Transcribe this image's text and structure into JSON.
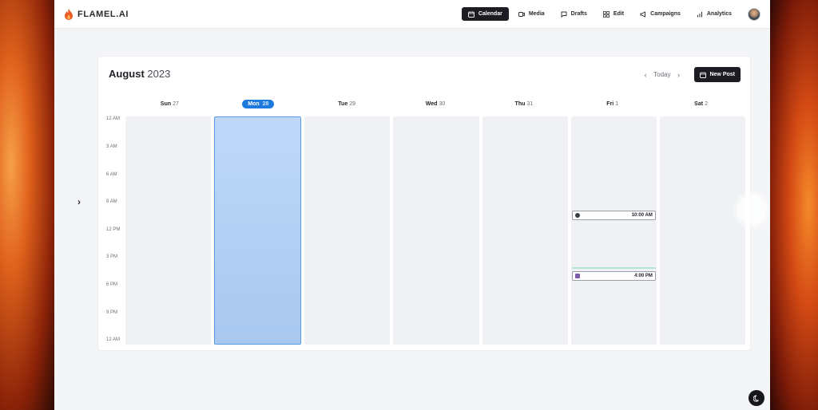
{
  "brand": {
    "name": "FLAMEL.AI",
    "accent": "#ef5a24"
  },
  "nav": {
    "items": [
      {
        "label": "Calendar",
        "icon": "calendar-icon",
        "active": true
      },
      {
        "label": "Media",
        "icon": "media-icon",
        "active": false
      },
      {
        "label": "Drafts",
        "icon": "drafts-icon",
        "active": false
      },
      {
        "label": "Edit",
        "icon": "edit-icon",
        "active": false
      },
      {
        "label": "Campaigns",
        "icon": "megaphone-icon",
        "active": false
      },
      {
        "label": "Analytics",
        "icon": "bar-chart-icon",
        "active": false
      }
    ]
  },
  "calendar": {
    "month": "August",
    "year": "2023",
    "today_label": "Today",
    "new_post_label": "New Post",
    "selected_color": "#1f7ae0",
    "days": [
      {
        "name": "Sun",
        "date": "27"
      },
      {
        "name": "Mon",
        "date": "28",
        "selected": true
      },
      {
        "name": "Tue",
        "date": "29"
      },
      {
        "name": "Wed",
        "date": "30"
      },
      {
        "name": "Thu",
        "date": "31"
      },
      {
        "name": "Fri",
        "date": "1"
      },
      {
        "name": "Sat",
        "date": "2"
      }
    ],
    "times": [
      "12 AM",
      "3 AM",
      "6 AM",
      "9 AM",
      "12 PM",
      "3 PM",
      "6 PM",
      "9 PM",
      "12 AM"
    ],
    "events": [
      {
        "day": "Fri",
        "time": "10:00 AM"
      },
      {
        "day": "Fri",
        "time": "4:00 PM"
      }
    ]
  }
}
